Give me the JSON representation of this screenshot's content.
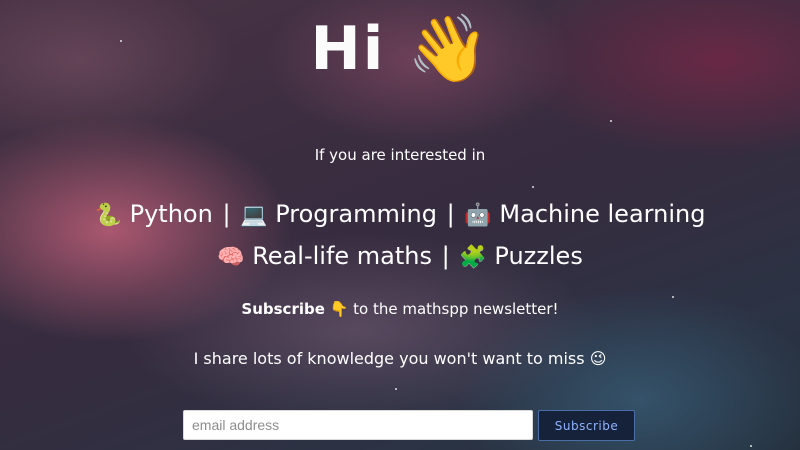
{
  "hero": {
    "greeting": "Hi",
    "greeting_icon": "👋",
    "intro": "If you are interested in",
    "topics_line1": [
      {
        "icon": "🐍",
        "label": "Python"
      },
      {
        "icon": "💻",
        "label": "Programming"
      },
      {
        "icon": "🤖",
        "label": "Machine learning"
      }
    ],
    "topics_line2": [
      {
        "icon": "🧠",
        "label": "Real-life maths"
      },
      {
        "icon": "🧩",
        "label": "Puzzles"
      }
    ],
    "separator": "|",
    "subscribe_bold": "Subscribe",
    "subscribe_icon": "👇",
    "subscribe_rest": "to the mathspp newsletter!",
    "knowledge": "I share lots of knowledge you won't want to miss",
    "knowledge_icon": "😉"
  },
  "form": {
    "email_placeholder": "email address",
    "email_value": "",
    "button_label": "Subscribe"
  },
  "colors": {
    "text": "#ffffff",
    "button_background": "#16213a",
    "button_text": "#8fb2ff",
    "button_border": "#4a6fa8"
  }
}
